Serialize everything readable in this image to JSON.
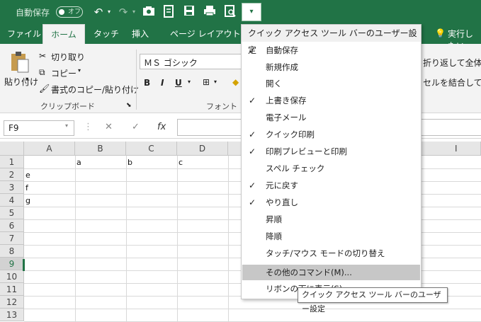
{
  "titlebar": {
    "autosave_label": "自動保存",
    "autosave_state": "オフ",
    "undo_icon": "undo-icon",
    "redo_icon": "redo-icon"
  },
  "ribbon_tabs": [
    "ファイル",
    "ホーム",
    "タッチ",
    "挿入",
    "ページ レイアウト"
  ],
  "tell_me": "実行したい",
  "ribbon": {
    "paste_label": "貼り付け",
    "cut_label": "切り取り",
    "copy_label": "コピー",
    "format_painter_label": "書式のコピー/貼り付け",
    "clipboard_group": "クリップボード",
    "font_name": "ＭＳ ゴシック",
    "bold": "B",
    "italic": "I",
    "underline": "U",
    "font_group": "フォント",
    "wrap_text": "折り返して全体を",
    "merge_center": "セルを結合して中"
  },
  "formula_bar": {
    "name_box": "F9",
    "cancel": "✕",
    "enter": "✓",
    "fx": "fx"
  },
  "sheet": {
    "columns": [
      "A",
      "B",
      "C",
      "D",
      "I"
    ],
    "rows": [
      "1",
      "2",
      "3",
      "4",
      "5",
      "6",
      "7",
      "8",
      "9",
      "10",
      "11",
      "12",
      "13"
    ],
    "cells": {
      "B1": "a",
      "C1": "b",
      "D1": "c",
      "A2": "e",
      "A3": "f",
      "A4": "g"
    }
  },
  "qat_menu": {
    "title": "クイック アクセス ツール バーのユーザー設定",
    "items": [
      {
        "label": "自動保存",
        "checked": true
      },
      {
        "label": "新規作成",
        "checked": false
      },
      {
        "label": "開く",
        "checked": false
      },
      {
        "label": "上書き保存",
        "checked": true
      },
      {
        "label": "電子メール",
        "checked": false
      },
      {
        "label": "クイック印刷",
        "checked": true
      },
      {
        "label": "印刷プレビューと印刷",
        "checked": true
      },
      {
        "label": "スペル チェック",
        "checked": false
      },
      {
        "label": "元に戻す",
        "checked": true
      },
      {
        "label": "やり直し",
        "checked": true
      },
      {
        "label": "昇順",
        "checked": false
      },
      {
        "label": "降順",
        "checked": false
      },
      {
        "label": "タッチ/マウス モードの切り替え",
        "checked": false
      },
      {
        "label": "その他のコマンド(M)...",
        "checked": false,
        "highlighted": true
      },
      {
        "label": "リボンの下に表示(S)",
        "checked": false
      }
    ],
    "check_mark": "✓"
  },
  "tooltip": "クイック アクセス ツール バーのユーザー設定"
}
